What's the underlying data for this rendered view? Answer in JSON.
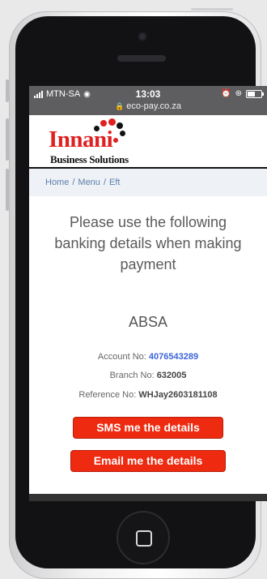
{
  "status_bar": {
    "carrier": "MTN-SA",
    "time": "13:03",
    "url": "eco-pay.co.za"
  },
  "logo": {
    "name": "Innani",
    "tagline": "Business Solutions",
    "dot_colors": [
      "#e02020",
      "#111111"
    ]
  },
  "breadcrumb": {
    "items": [
      "Home",
      "Menu",
      "Eft"
    ],
    "separator": "/"
  },
  "content": {
    "instructions": "Please use the following banking details when making payment",
    "bank_name": "ABSA",
    "account": {
      "label": "Account No:",
      "value": "4076543289"
    },
    "branch": {
      "label": "Branch No:",
      "value": "632005"
    },
    "reference": {
      "label": "Reference No:",
      "value": "WHJay2603181108"
    }
  },
  "actions": {
    "sms_label": "SMS me the details",
    "email_label": "Email me the details"
  },
  "colors": {
    "accent_button": "#ee2a10",
    "link": "#3b64d8",
    "breadcrumb_bg": "#eef2f7"
  }
}
